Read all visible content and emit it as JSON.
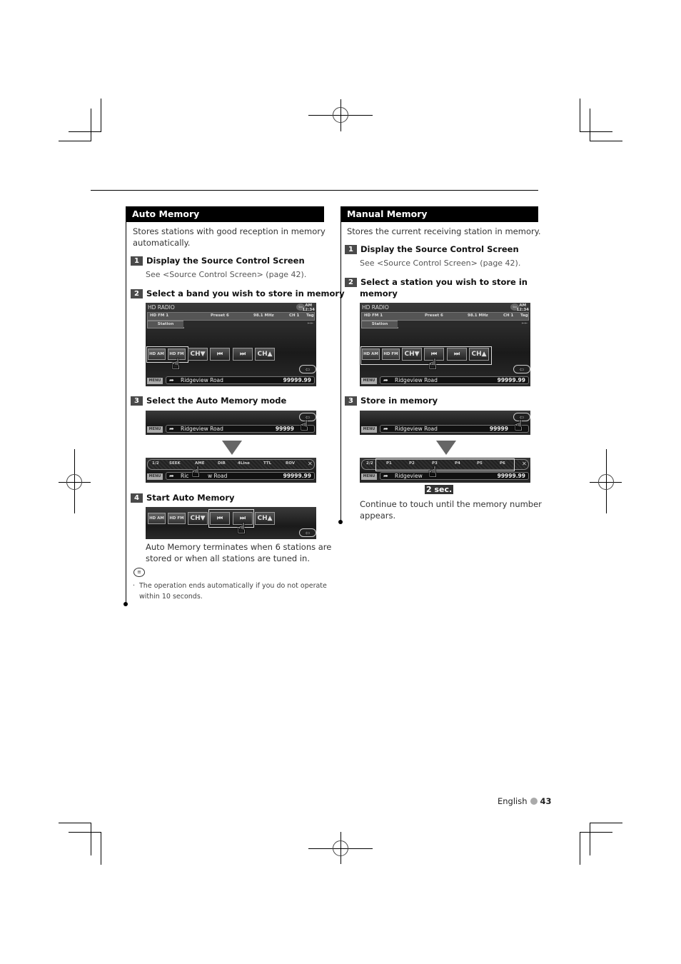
{
  "page": {
    "language": "English",
    "page_number": "43"
  },
  "auto_memory": {
    "title": "Auto Memory",
    "intro_line1": "Stores stations with good reception in memory",
    "intro_line2": "automatically.",
    "steps": [
      {
        "num": "1",
        "label": "Display the Source Control Screen",
        "note": "See <Source Control Screen> (page 42)."
      },
      {
        "num": "2",
        "label": "Select a band you wish to store in memory"
      },
      {
        "num": "3",
        "label": "Select the Auto Memory mode"
      },
      {
        "num": "4",
        "label": "Start Auto Memory",
        "note_line1": "Auto Memory terminates when 6 stations are",
        "note_line2": "stored or when all stations are tuned in."
      }
    ],
    "tip_line1": "The operation ends automatically if you do not operate",
    "tip_line2": "within 10 seconds.",
    "function_bar": [
      "1/2",
      "SEEK",
      "AME",
      "DIR",
      "4Line",
      "TTL",
      "ROV"
    ]
  },
  "manual_memory": {
    "title": "Manual Memory",
    "intro": "Stores the current receiving station in memory.",
    "steps": [
      {
        "num": "1",
        "label": "Display the Source Control Screen",
        "note": "See <Source Control Screen> (page 42)."
      },
      {
        "num": "2",
        "label_line1": "Select a station you wish to store in",
        "label_line2": "memory"
      },
      {
        "num": "3",
        "label": "Store in memory",
        "note_line1": "Continue to touch until the memory number",
        "note_line2": "appears."
      }
    ],
    "hold_label": "2 sec.",
    "preset_bar": [
      "2/2",
      "P1",
      "P2",
      "P3",
      "P4",
      "P5",
      "P6"
    ]
  },
  "screen": {
    "title": "HD RADIO",
    "band": "HD FM 1",
    "preset": "Preset 6",
    "freq": "98.1 MHz",
    "channel": "CH 1",
    "tag": "Tag",
    "station_btn": "Station",
    "clock_ampm": "AM",
    "clock_time": "12:34",
    "buttons": {
      "hd_am": "HD AM",
      "hd_fm": "HD FM",
      "ch_down": "CH▼",
      "prev": "⏮",
      "next": "⏭",
      "ch_up": "CH▲"
    },
    "menu": "MENU",
    "road": "Ridgeview Road",
    "road_partial": "Ric",
    "road_partial2": "w Road",
    "road_partial_manual": "Ridgeview",
    "distance": "99999.99",
    "distance_partial": "99999",
    "close": "✕"
  }
}
